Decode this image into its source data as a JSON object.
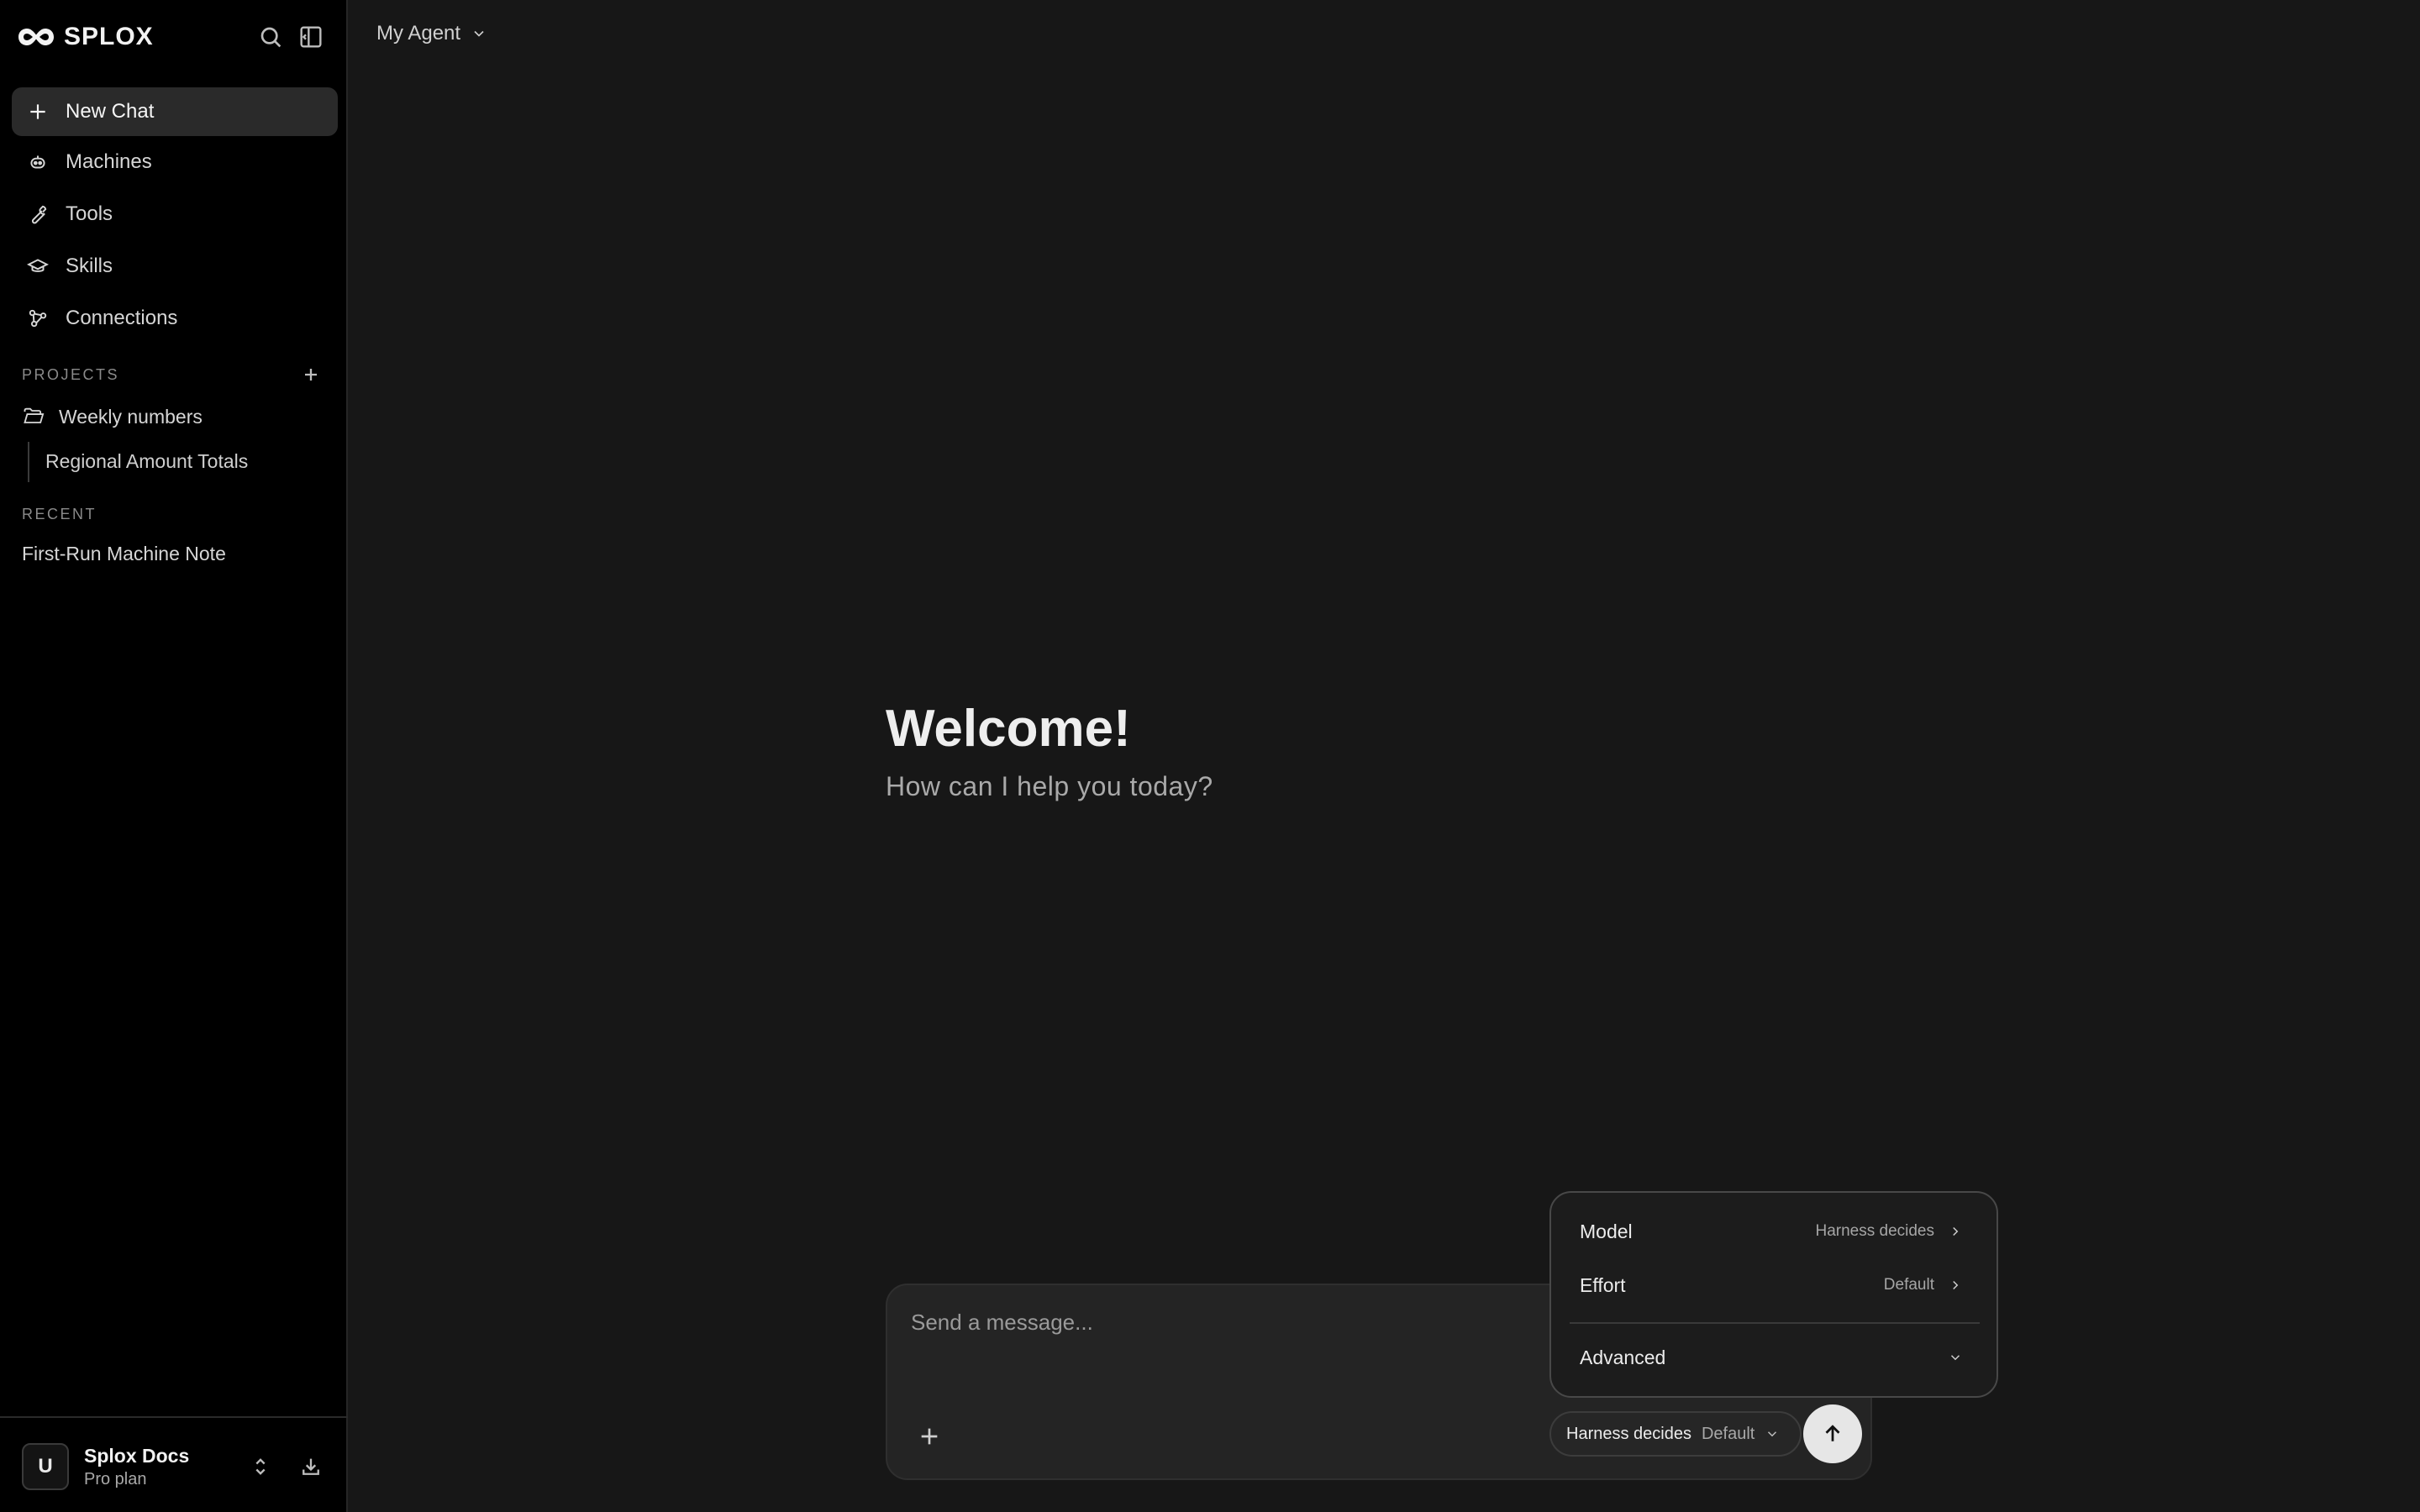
{
  "sidebar": {
    "brand": "SPLOX",
    "icons": [
      "infinity-logo",
      "search-icon",
      "collapse-sidebar-icon"
    ],
    "nav": [
      {
        "label": "New Chat",
        "icon": "plus-icon",
        "active": true
      },
      {
        "label": "Machines",
        "icon": "robot-icon"
      },
      {
        "label": "Tools",
        "icon": "wrench-icon"
      },
      {
        "label": "Skills",
        "icon": "graduation-cap-icon"
      },
      {
        "label": "Connections",
        "icon": "nodes-icon"
      }
    ],
    "projects_label": "PROJECTS",
    "project_folder": "Weekly numbers",
    "project_child": "Regional Amount Totals",
    "recent_label": "RECENT",
    "recent_items": [
      "First-Run Machine Note"
    ],
    "account": {
      "avatar_letter": "U",
      "name": "Splox Docs",
      "plan": "Pro plan"
    }
  },
  "header": {
    "agent_name": "My Agent"
  },
  "main": {
    "welcome": "Welcome!",
    "subtitle": "How can I help you today?"
  },
  "composer": {
    "placeholder": "Send a message...",
    "pill_model": "Harness decides",
    "pill_effort": "Default"
  },
  "popover": {
    "rows": [
      {
        "label": "Model",
        "value": "Harness decides"
      },
      {
        "label": "Effort",
        "value": "Default"
      }
    ],
    "advanced_label": "Advanced"
  },
  "colors": {
    "sidebar_bg": "#000000",
    "main_bg": "#171717",
    "composer_bg": "#242424",
    "active_item_bg": "#2a2a2a",
    "send_button": "#e6e6e6"
  }
}
